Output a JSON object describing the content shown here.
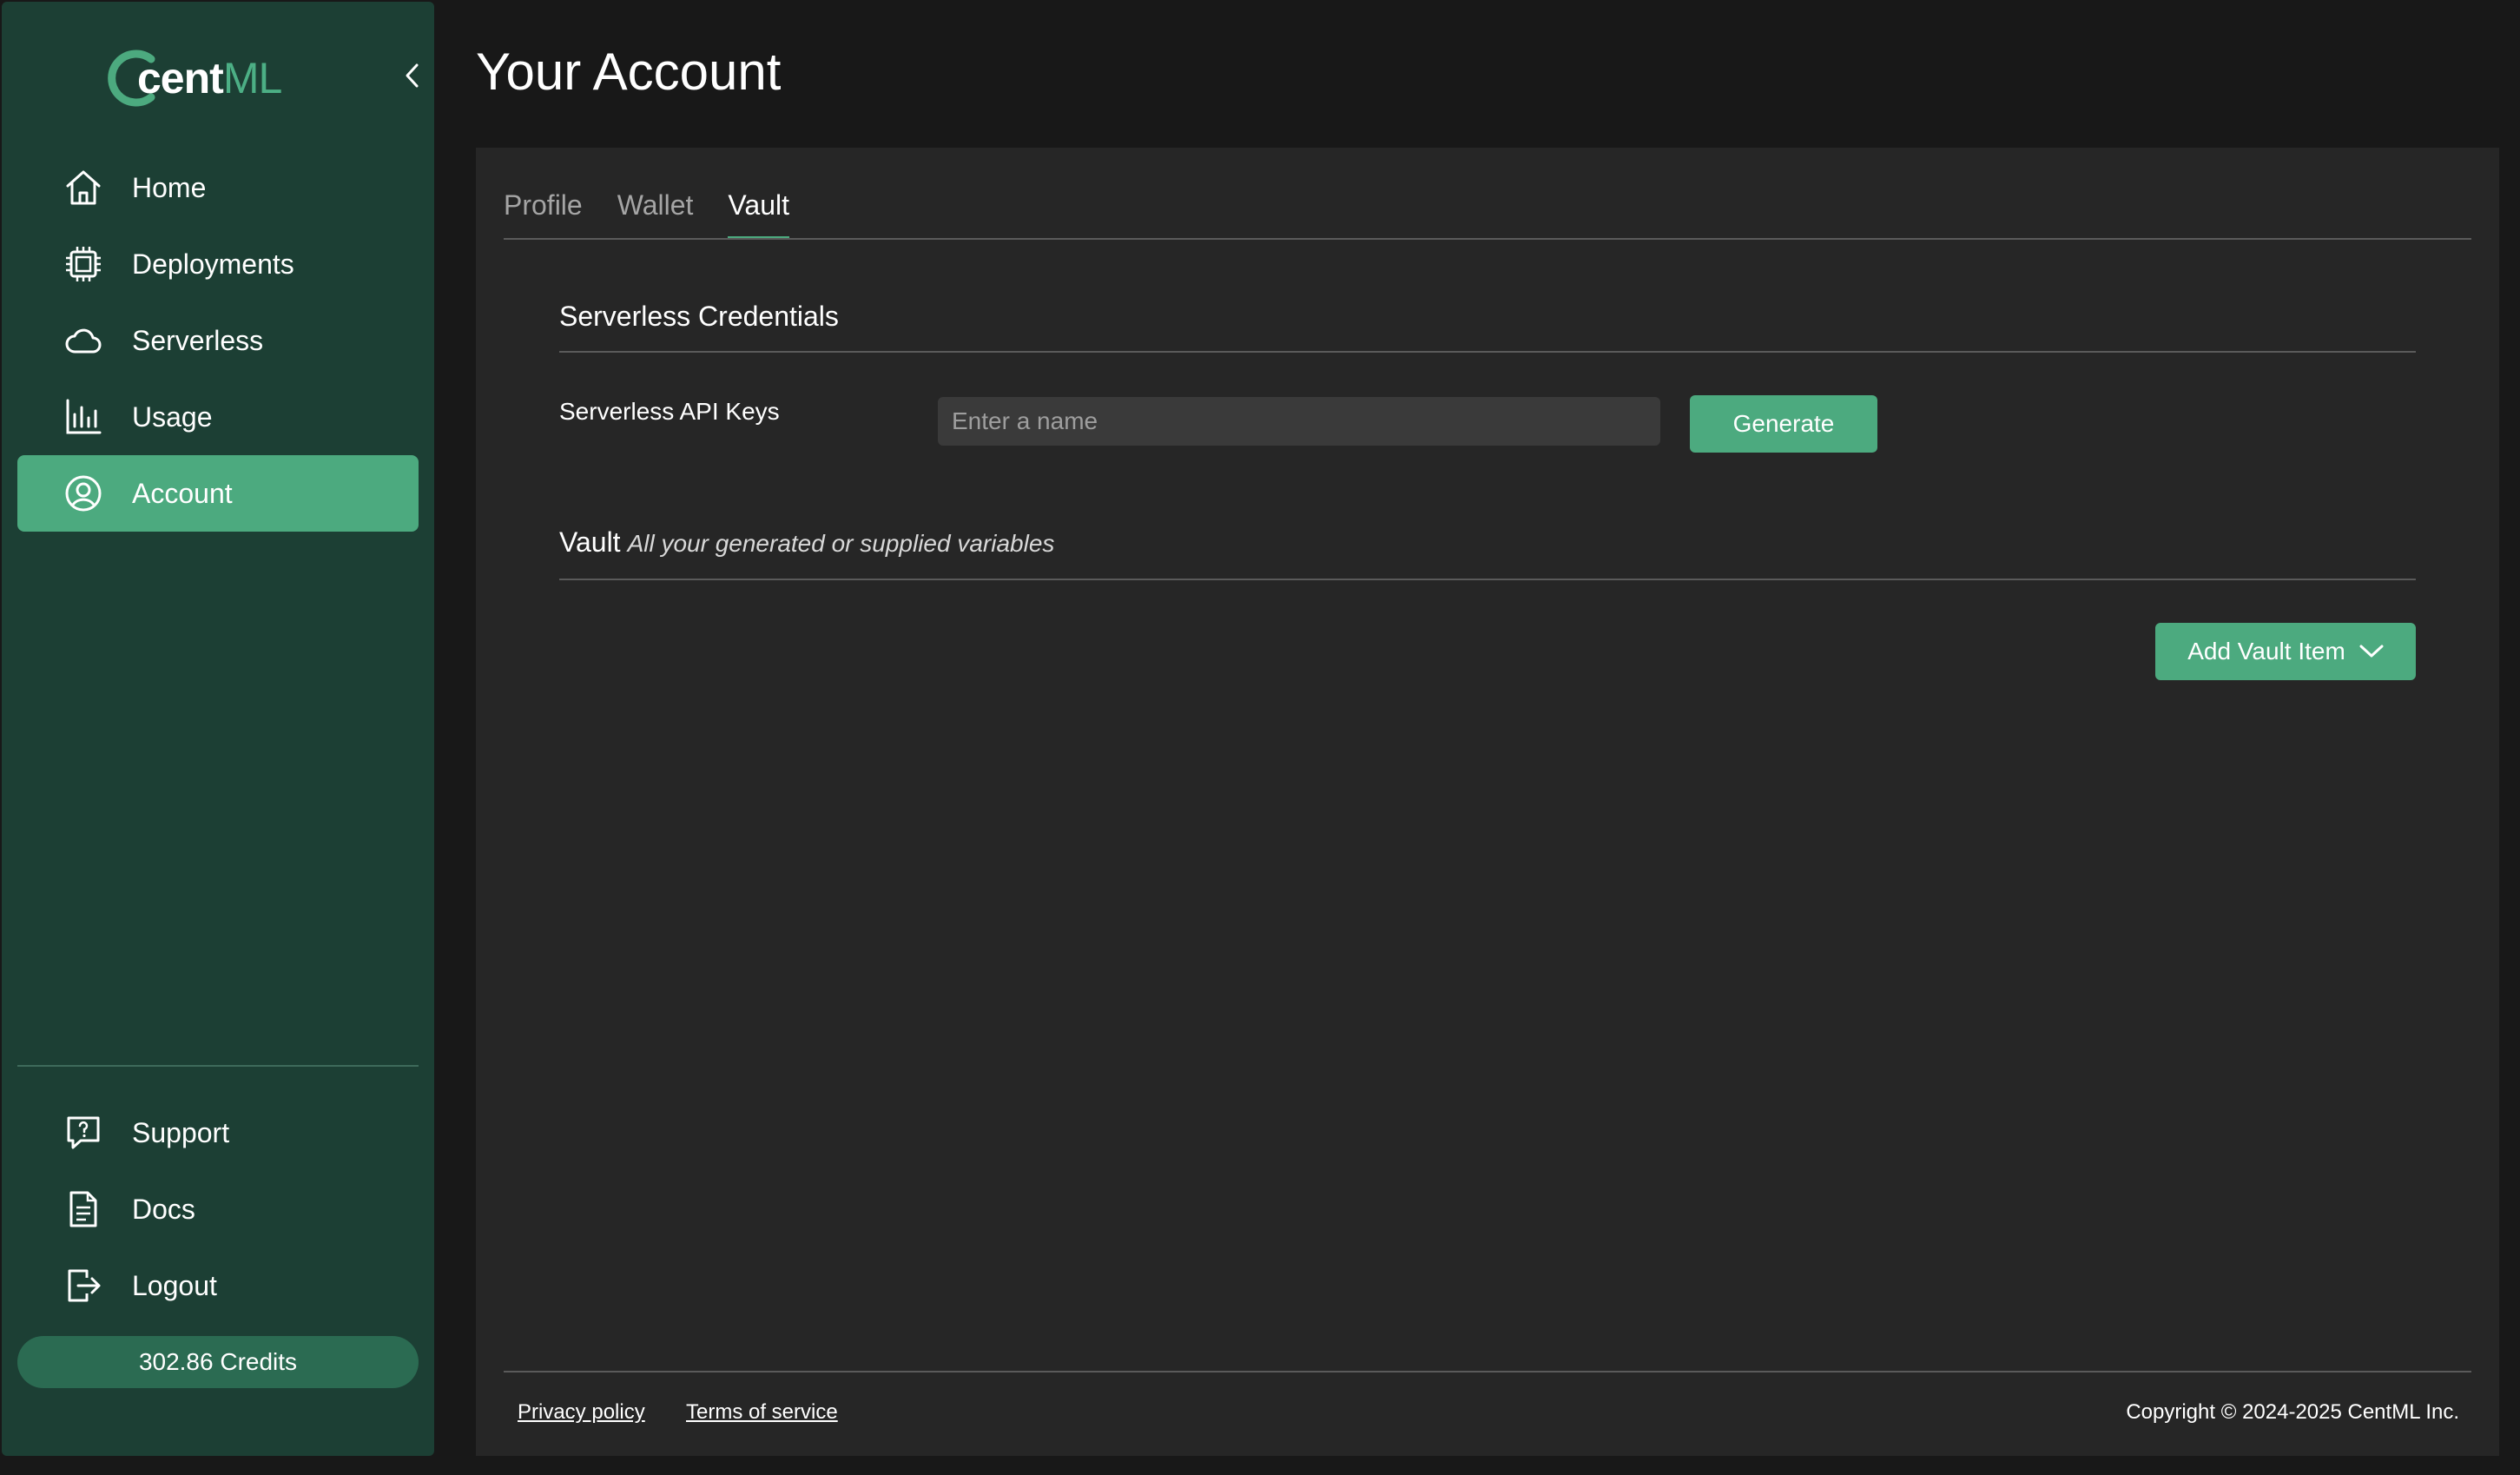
{
  "brand": {
    "name_part1": "cent",
    "name_part2": "ML",
    "accent_color": "#4caa7f"
  },
  "sidebar": {
    "collapse_icon": "chevron-left-icon",
    "nav": [
      {
        "label": "Home",
        "icon": "home-icon"
      },
      {
        "label": "Deployments",
        "icon": "chip-icon"
      },
      {
        "label": "Serverless",
        "icon": "cloud-icon"
      },
      {
        "label": "Usage",
        "icon": "bar-chart-icon"
      },
      {
        "label": "Account",
        "icon": "user-circle-icon",
        "active": true
      }
    ],
    "bottom_nav": [
      {
        "label": "Support",
        "icon": "help-chat-icon"
      },
      {
        "label": "Docs",
        "icon": "document-icon"
      },
      {
        "label": "Logout",
        "icon": "logout-icon"
      }
    ],
    "credits": "302.86 Credits"
  },
  "page": {
    "title": "Your Account"
  },
  "tabs": [
    {
      "label": "Profile"
    },
    {
      "label": "Wallet"
    },
    {
      "label": "Vault",
      "active": true
    }
  ],
  "credentials": {
    "title": "Serverless Credentials",
    "api_keys_label": "Serverless API Keys",
    "name_placeholder": "Enter a name",
    "name_value": "",
    "generate_label": "Generate"
  },
  "vault": {
    "title": "Vault",
    "subtitle": "All your generated or supplied variables",
    "add_label": "Add Vault Item"
  },
  "footer": {
    "privacy": "Privacy policy",
    "terms": "Terms of service",
    "copyright": "Copyright © 2024-2025 CentML Inc."
  }
}
